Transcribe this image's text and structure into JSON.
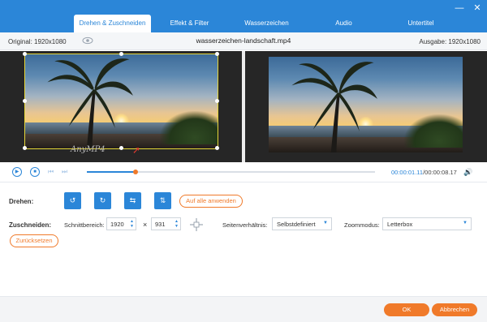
{
  "window": {
    "minimize_glyph": "—",
    "close_glyph": "✕"
  },
  "tabs": [
    {
      "label": "Drehen & Zuschneiden",
      "active": true
    },
    {
      "label": "Effekt & Filter",
      "active": false
    },
    {
      "label": "Wasserzeichen",
      "active": false
    },
    {
      "label": "Audio",
      "active": false
    },
    {
      "label": "Untertitel",
      "active": false
    }
  ],
  "infobar": {
    "original": "Original: 1920x1080",
    "filename": "wasserzeichen-landschaft.mp4",
    "output": "Ausgabe: 1920x1080",
    "eye_icon": "eye-icon"
  },
  "preview": {
    "watermark_text": "AnyMP4",
    "watermark_arrow": "➚"
  },
  "player": {
    "play_glyph": "▶",
    "stop_glyph": "■",
    "prev_glyph": "⏮",
    "next_glyph": "⏭",
    "progress": 0.17,
    "current_time": "00:00:01.11",
    "separator": "/",
    "total_time": "00:00:08.17",
    "volume_glyph": "🔊"
  },
  "rotate": {
    "label": "Drehen:",
    "buttons": [
      {
        "name": "rotate-left",
        "glyph": "↺"
      },
      {
        "name": "rotate-right",
        "glyph": "↻"
      },
      {
        "name": "flip-horizontal",
        "glyph": "⇆"
      },
      {
        "name": "flip-vertical",
        "glyph": "⇅"
      }
    ],
    "apply_all": "Auf alle anwenden"
  },
  "crop": {
    "label": "Zuschneiden:",
    "area_label": "Schnittbereich:",
    "width": "1920",
    "height": "931",
    "times": "×",
    "aspect_label": "Seitenverhältnis:",
    "aspect_value": "Selbstdefiniert",
    "zoom_label": "Zoommodus:",
    "zoom_value": "Letterbox",
    "reset": "Zurücksetzen"
  },
  "footer": {
    "ok": "OK",
    "cancel": "Abbrechen"
  },
  "colors": {
    "accent": "#2b86d8",
    "orange": "#f07a2a",
    "crop_frame": "#e6d73a"
  }
}
